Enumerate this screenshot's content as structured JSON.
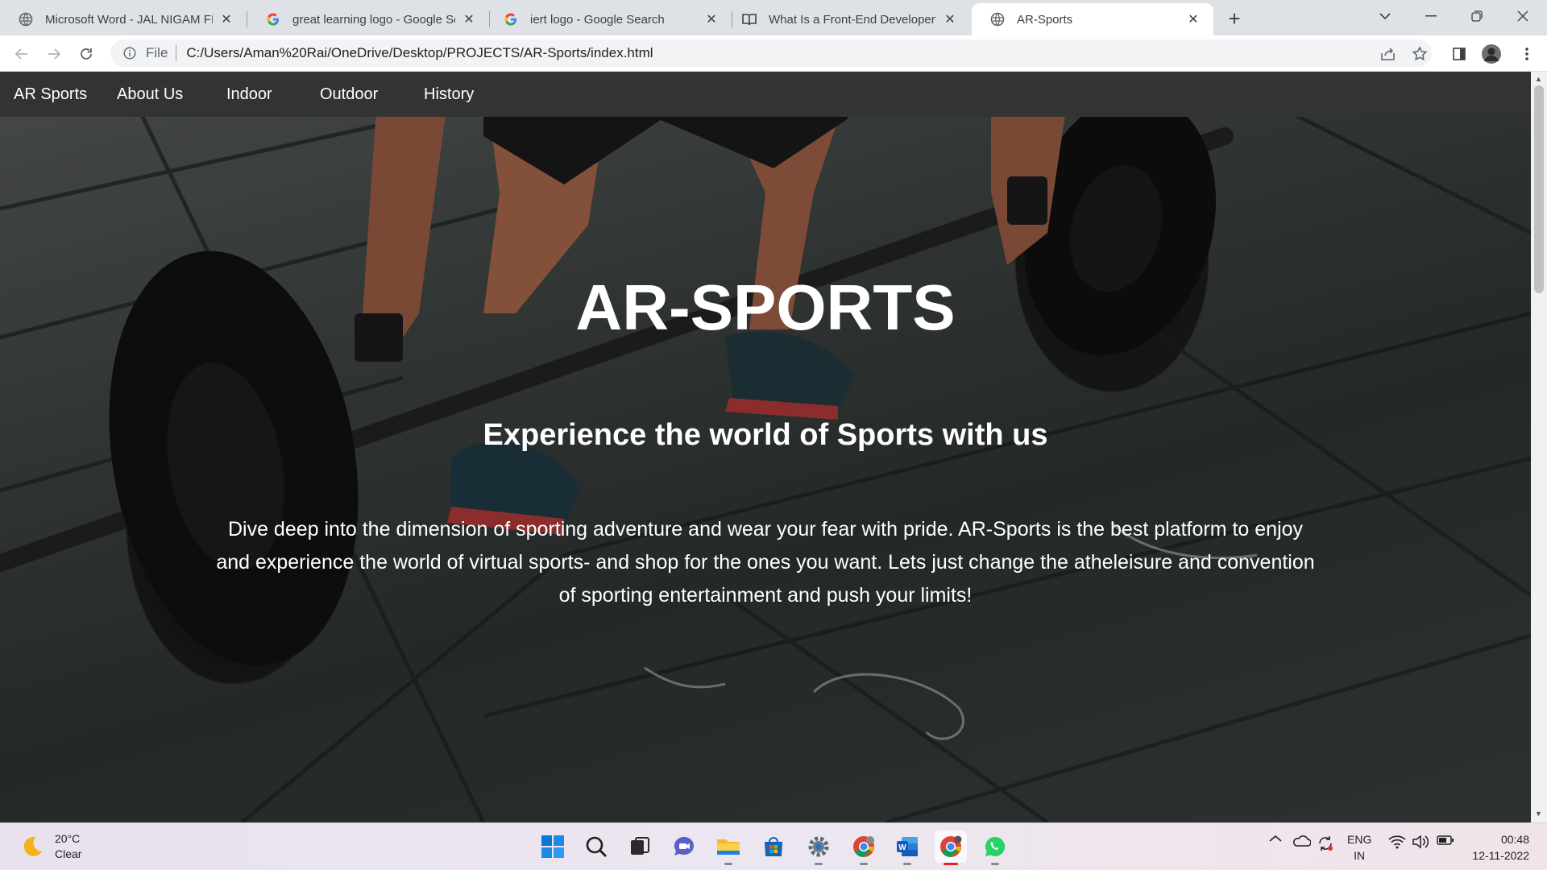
{
  "browser": {
    "tabs": [
      {
        "title": "Microsoft Word - JAL NIGAM FIR",
        "icon": "globe-icon"
      },
      {
        "title": "great learning logo - Google Sea",
        "icon": "google-icon"
      },
      {
        "title": "iert logo - Google Search",
        "icon": "google-icon"
      },
      {
        "title": "What Is a Front-End Developer?",
        "icon": "book-icon"
      },
      {
        "title": "AR-Sports",
        "icon": "globe-icon",
        "active": true
      }
    ],
    "address": {
      "scheme": "File",
      "url": "C:/Users/Aman%20Rai/OneDrive/Desktop/PROJECTS/AR-Sports/index.html"
    }
  },
  "site": {
    "nav": {
      "brand": "AR Sports",
      "links": [
        "About Us",
        "Indoor",
        "Outdoor",
        "History"
      ]
    },
    "hero": {
      "title": "AR-SPORTS",
      "subtitle": "Experience the world of Sports with us",
      "text": "Dive deep into the dimension of sporting adventure and wear your fear with pride. AR-Sports is the best platform to enjoy and experience the world of virtual sports- and shop for the ones you want. Lets just change the atheleisure and convention of sporting entertainment and push your limits!"
    }
  },
  "taskbar": {
    "weather": {
      "temp": "20°C",
      "condition": "Clear"
    },
    "apps": [
      "start-icon",
      "search-icon",
      "task-view-icon",
      "chat-icon",
      "file-explorer-icon",
      "microsoft-store-icon",
      "settings-icon",
      "chrome-icon",
      "word-icon",
      "chrome-icon",
      "whatsapp-icon"
    ],
    "language": {
      "lang": "ENG",
      "region": "IN"
    },
    "clock": {
      "time": "00:48",
      "date": "12-11-2022"
    }
  },
  "colors": {
    "nav_bg": "#333333",
    "tab_strip": "#dee1e6",
    "active_indicator": "#dd2222"
  }
}
